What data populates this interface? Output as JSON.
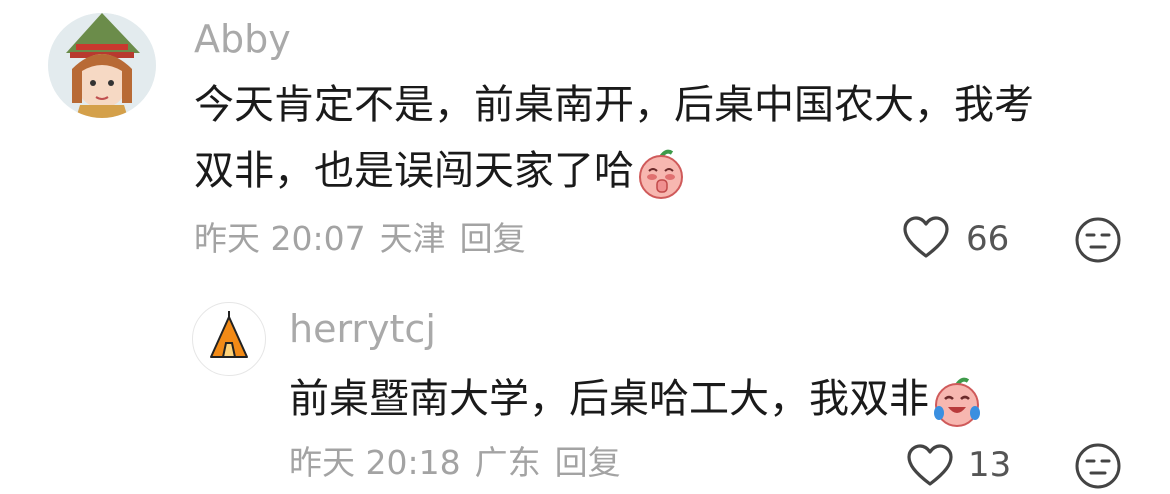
{
  "comments": [
    {
      "username": "Abby",
      "text_line1": "今天肯定不是，前桌南开，后桌中国农大，我考",
      "text_line2": "双非，也是误闯天家了哈",
      "time": "昨天 20:07",
      "location": "天津",
      "reply_label": "回复",
      "likes": "66",
      "emoji": "shy-face-emoji"
    },
    {
      "username": "herrytcj",
      "text": "前桌暨南大学，后桌哈工大，我双非",
      "time": "昨天 20:18",
      "location": "广东",
      "reply_label": "回复",
      "likes": "13",
      "emoji": "laugh-cry-emoji"
    }
  ],
  "icons": [
    "heart-icon",
    "dislike-face-icon"
  ],
  "colors": {
    "text": "#1a1a1a",
    "meta": "#a3a3a3",
    "username": "#a9a9a9",
    "tent": "#f28a16"
  }
}
